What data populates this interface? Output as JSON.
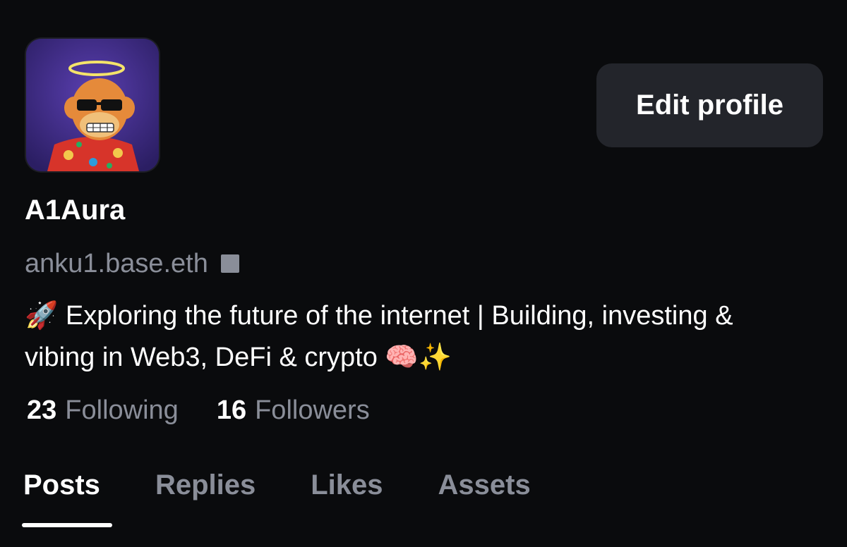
{
  "profile": {
    "avatar_icon": "bored-ape-avatar-icon",
    "display_name": "A1Aura",
    "handle": "anku1.base.eth",
    "verify_icon": "square-badge-icon",
    "bio_prefix_emoji": "🚀",
    "bio_text": "Exploring the future of the internet | Building, investing & vibing in Web3, DeFi & crypto",
    "bio_suffix_emoji": "🧠✨"
  },
  "actions": {
    "edit_profile_label": "Edit profile"
  },
  "stats": {
    "following_count": "23",
    "following_label": "Following",
    "followers_count": "16",
    "followers_label": "Followers"
  },
  "tabs": [
    {
      "label": "Posts",
      "active": true
    },
    {
      "label": "Replies",
      "active": false
    },
    {
      "label": "Likes",
      "active": false
    },
    {
      "label": "Assets",
      "active": false
    }
  ],
  "colors": {
    "background": "#0a0b0d",
    "muted_text": "#8a8e99",
    "button_bg": "#23252b",
    "primary_text": "#ffffff"
  }
}
